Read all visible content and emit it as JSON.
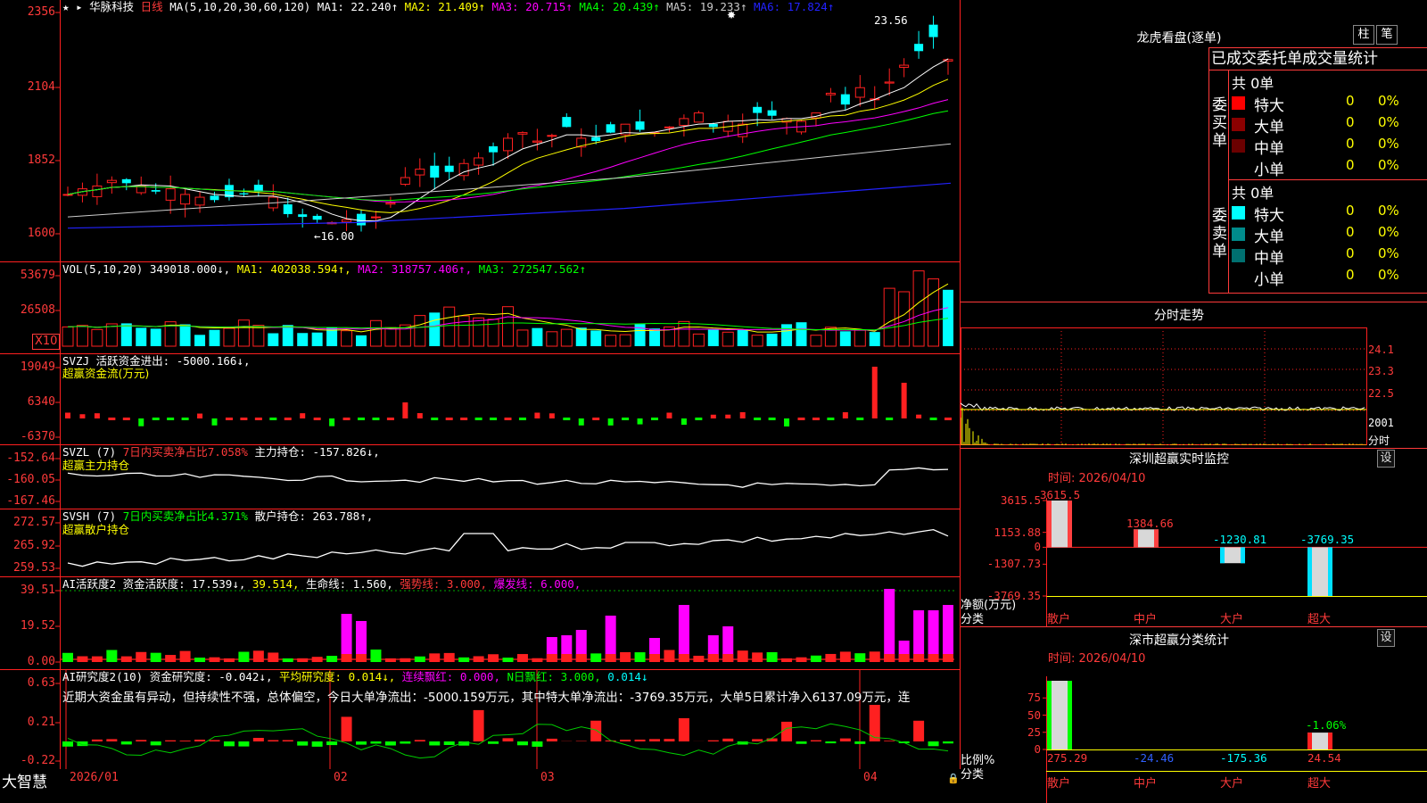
{
  "main": {
    "stock_name": "华脉科技",
    "period": "日线",
    "ma_label": "MA(5,10,20,30,60,120)",
    "ma": [
      {
        "name": "MA1:",
        "value": "22.240↑",
        "color": "#ffffff"
      },
      {
        "name": "MA2:",
        "value": "21.409↑",
        "color": "#ffff00"
      },
      {
        "name": "MA3:",
        "value": "20.715↑",
        "color": "#ff00ff"
      },
      {
        "name": "MA4:",
        "value": "20.439↑",
        "color": "#00ff00"
      },
      {
        "name": "MA5:",
        "value": "19.233↑",
        "color": "#cccccc"
      },
      {
        "name": "MA6:",
        "value": "17.824↑",
        "color": "#2222ff"
      }
    ],
    "yticks": [
      "2356",
      "2104",
      "1852",
      "1600"
    ],
    "high_label": "23.56",
    "low_label": "16.00"
  },
  "vol": {
    "label": "VOL(5,10,20)",
    "value": "349018.000↓,",
    "ma1": "MA1: 402038.594↑,",
    "ma2": "MA2: 318757.406↑,",
    "ma3": "MA3: 272547.562↑",
    "yticks": [
      "53679",
      "26508"
    ],
    "unit": "X10"
  },
  "svzj": {
    "label": "SVZJ",
    "text1": "活跃资金进出: -5000.166↓,",
    "text2": "超赢资金流(万元)",
    "yticks": [
      "19049",
      "6340",
      "-6370"
    ]
  },
  "svzl": {
    "label": "SVZL (7)",
    "text1": "7日内买卖净占比7.058%",
    "text2": "主力持仓: -157.826↓,",
    "text3": "超赢主力持仓",
    "yticks": [
      "-152.64",
      "-160.05",
      "-167.46"
    ]
  },
  "svsh": {
    "label": "SVSH (7)",
    "text1": "7日内买卖净占比4.371%",
    "text2": "散户持仓: 263.788↑,",
    "text3": "超赢散户持仓",
    "yticks": [
      "272.57",
      "265.92",
      "259.53"
    ]
  },
  "ai1": {
    "label": "AI活跃度2",
    "t1": "资金活跃度: 17.539↓,",
    "t2": "39.514,",
    "t3": "生命线: 1.560,",
    "t4": "强势线: 3.000,",
    "t5": "爆发线: 6.000,",
    "yticks": [
      "39.51",
      "19.52",
      "0.00"
    ]
  },
  "ai2": {
    "label": "AI研究度2(10)",
    "t1": "资金研究度: -0.042↓,",
    "t2": "平均研究度: 0.014↓,",
    "t3": "连续飘红: 0.000,",
    "t4": "N日飘红: 3.000,",
    "t5": "0.014↓",
    "comment": "近期大资金虽有异动，但持续性不强，总体偏空，今日大单净流出：-5000.159万元，其中特大单净流出：-3769.35万元，大单5日累计净入6137.09万元，连",
    "yticks": [
      "0.63",
      "0.21",
      "-0.22"
    ]
  },
  "xaxis": {
    "brand": "大智慧",
    "labels": [
      "2026/01",
      "02",
      "03",
      "04"
    ]
  },
  "dragon": {
    "title": "龙虎看盘(逐单)",
    "btn1": "柱",
    "btn2": "笔",
    "tab1": "已成交",
    "tab2": "委托单",
    "tab3": "成交量统计",
    "buy_total": "共 0单",
    "buy_side": "委买单",
    "sell_total": "共 0单",
    "sell_side": "委卖单",
    "buy_rows": [
      {
        "name": "特大",
        "count": "0",
        "pct": "0%",
        "color": "#ff0000"
      },
      {
        "name": "大单",
        "count": "0",
        "pct": "0%",
        "color": "#8b0000"
      },
      {
        "name": "中单",
        "count": "0",
        "pct": "0%",
        "color": "#6b0000"
      },
      {
        "name": "小单",
        "count": "0",
        "pct": "0%",
        "color": ""
      }
    ],
    "sell_rows": [
      {
        "name": "特大",
        "count": "0",
        "pct": "0%",
        "color": "#00ffff"
      },
      {
        "name": "大单",
        "count": "0",
        "pct": "0%",
        "color": "#008b8b"
      },
      {
        "name": "中单",
        "count": "0",
        "pct": "0%",
        "color": "#007070"
      },
      {
        "name": "小单",
        "count": "0",
        "pct": "0%",
        "color": ""
      }
    ]
  },
  "intraday": {
    "title": "分时走势",
    "yticks": [
      "24.1",
      "23.3",
      "22.5",
      "2001",
      "分时"
    ]
  },
  "monitor": {
    "title": "深圳超赢实时监控",
    "set": "设",
    "time_label": "时间: 2026/04/10",
    "yticks": [
      "3615.5",
      "1153.88",
      "0",
      "-1307.73",
      "-3769.35"
    ],
    "axis_title": "净额(万元)",
    "cat_title": "分类",
    "categories": [
      "散户",
      "中户",
      "大户",
      "超大"
    ],
    "value_labels": [
      "3615.5",
      "1384.66",
      "-1230.81",
      "-3769.35"
    ]
  },
  "classify": {
    "title": "深市超赢分类统计",
    "set": "设",
    "time_label": "时间: 2026/04/10",
    "yticks": [
      "75",
      "50",
      "25",
      "0"
    ],
    "axis_title": "比例%",
    "cat_title": "分类",
    "categories": [
      "散户",
      "中户",
      "大户",
      "超大"
    ],
    "values": [
      "275.29",
      "-24.46",
      "-175.36",
      "24.54"
    ],
    "top_label": "-1.06%"
  },
  "chart_data": [
    {
      "type": "bar",
      "title": "深圳超赢实时监控",
      "ylabel": "净额(万元)",
      "xlabel": "分类",
      "categories": [
        "散户",
        "中户",
        "大户",
        "超大"
      ],
      "values": [
        3615.5,
        1384.66,
        -1230.81,
        -3769.35
      ],
      "ylim": [
        -3769.35,
        3615.5
      ]
    },
    {
      "type": "bar",
      "title": "深市超赢分类统计",
      "ylabel": "比例%",
      "xlabel": "分类",
      "categories": [
        "散户",
        "中户",
        "大户",
        "超大"
      ],
      "values": [
        275.29,
        -24.46,
        -175.36,
        24.54
      ],
      "ylim": [
        0,
        75
      ]
    }
  ]
}
